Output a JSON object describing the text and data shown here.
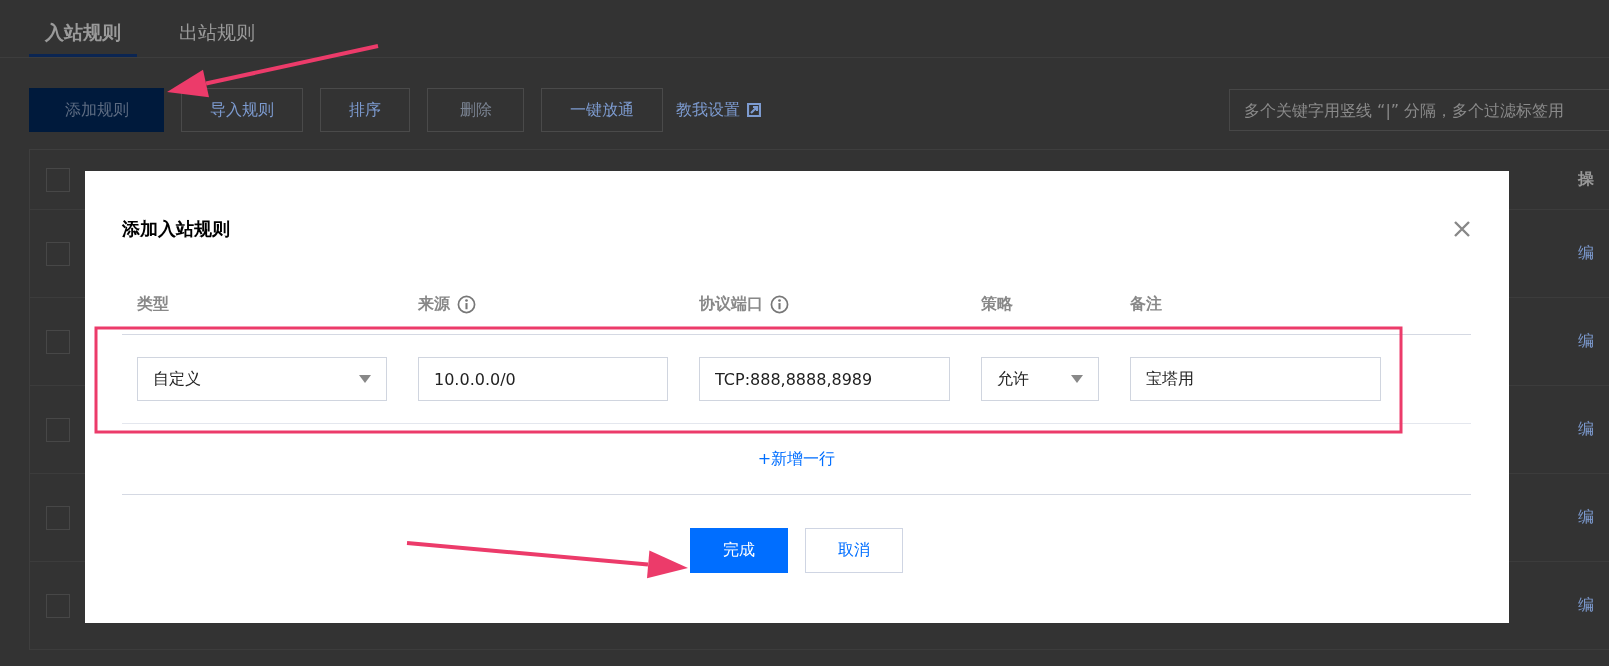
{
  "tabs": [
    {
      "label": "入站规则",
      "selected": true
    },
    {
      "label": "出站规则",
      "selected": false
    }
  ],
  "toolbar": {
    "buttons": [
      {
        "label": "添加规则",
        "kind": "primary"
      },
      {
        "label": "导入规则",
        "kind": "default"
      },
      {
        "label": "排序",
        "kind": "default"
      },
      {
        "label": "删除",
        "kind": "disabled"
      },
      {
        "label": "一键放通",
        "kind": "default"
      }
    ],
    "help_link": "教我设置",
    "search": {
      "placeholder": "多个关键字用竖线 “|” 分隔，多个过滤标签用"
    }
  },
  "table": {
    "header": {
      "checked": false,
      "column_last": "操"
    },
    "rows": [
      {
        "checked": false,
        "action": "编"
      },
      {
        "checked": false,
        "action": "编"
      },
      {
        "checked": false,
        "action": "编"
      },
      {
        "checked": false,
        "action": "编"
      },
      {
        "checked": false,
        "action": "编"
      }
    ]
  },
  "dialog": {
    "title": "添加入站规则",
    "columns": [
      {
        "label": "类型",
        "kind": "plain"
      },
      {
        "label": "来源",
        "kind": "info"
      },
      {
        "label": "协议端口",
        "kind": "info"
      },
      {
        "label": "策略",
        "kind": "plain"
      },
      {
        "label": "备注",
        "kind": "plain"
      }
    ],
    "rows": [
      {
        "fields": [
          {
            "kind": "select",
            "value": "自定义"
          },
          {
            "kind": "input",
            "value": "10.0.0.0/0"
          },
          {
            "kind": "input",
            "value": "TCP:888,8888,8989"
          },
          {
            "kind": "select",
            "value": "允许"
          },
          {
            "kind": "input",
            "value": "宝塔用"
          }
        ]
      }
    ],
    "add_row": "+新增一行",
    "buttons": [
      {
        "label": "完成",
        "kind": "primary"
      },
      {
        "label": "取消",
        "kind": "default"
      }
    ]
  }
}
